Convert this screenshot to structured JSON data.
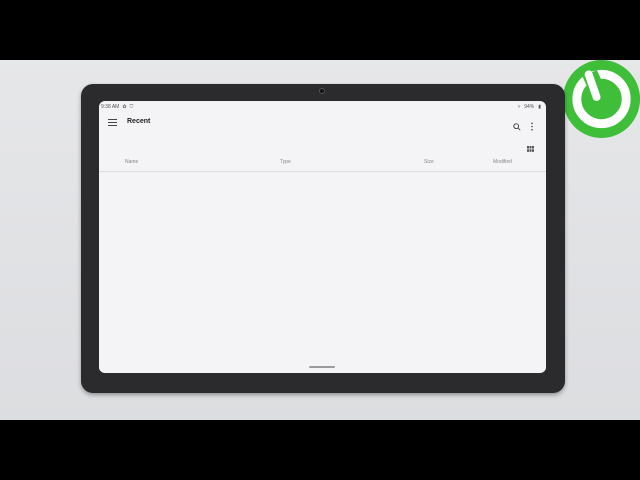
{
  "status_bar": {
    "time": "9:38 AM",
    "battery": "94%"
  },
  "app_bar": {
    "title": "Recent",
    "menu_icon": "hamburger-menu-icon",
    "search_icon": "search-icon",
    "more_icon": "more-vert-icon",
    "view_icon": "grid-view-icon"
  },
  "columns": [
    {
      "label": "Name"
    },
    {
      "label": "Type"
    },
    {
      "label": "Size"
    },
    {
      "label": "Modified"
    }
  ],
  "colors": {
    "logo_green": "#3fbe3a",
    "screen_bg": "#f4f4f6",
    "bezel": "#2b2b2d"
  }
}
